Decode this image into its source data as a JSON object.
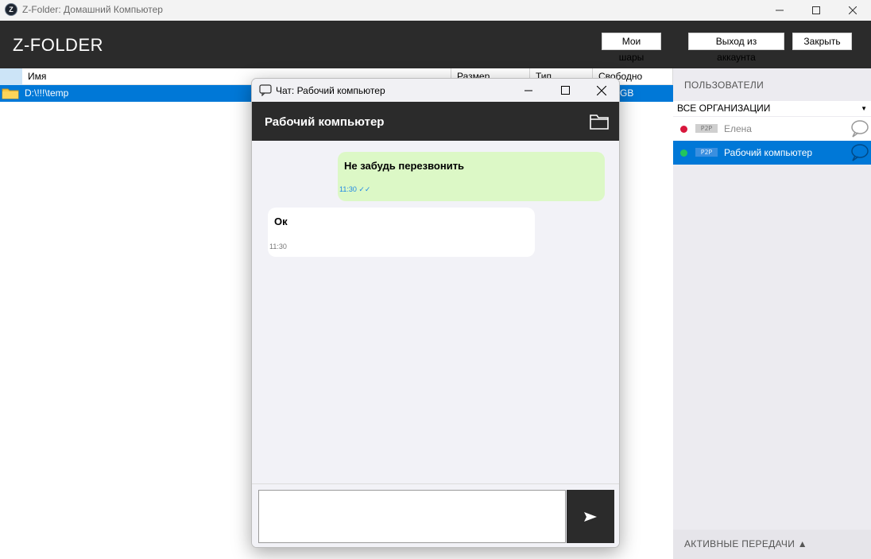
{
  "window": {
    "app_icon_letter": "Z",
    "title": "Z-Folder: Домашний Компьютер"
  },
  "header": {
    "brand": "Z-FOLDER",
    "my_shares_label": "Мои шары",
    "logout_label": "Выход из аккаунта",
    "close_label": "Закрыть"
  },
  "table": {
    "columns": [
      "Имя",
      "Размер",
      "Тип",
      "Свободно"
    ],
    "rows": [
      {
        "name": "D:\\!!!\\temp",
        "size": "",
        "type": "",
        "free": "GB"
      }
    ]
  },
  "users_panel": {
    "title": "ПОЛЬЗОВАТЕЛИ",
    "org_filter": "ВСЕ ОРГАНИЗАЦИИ",
    "users": [
      {
        "name": "Елена",
        "badge": "P2P",
        "status_color": "#d8173c",
        "selected": false
      },
      {
        "name": "Рабочий компьютер",
        "badge": "P2P",
        "status_color": "#22c55e",
        "selected": true
      }
    ],
    "transfers_label": "АКТИВНЫЕ ПЕРЕДАЧИ ▲"
  },
  "chat": {
    "window_title": "Чат: Рабочий компьютер",
    "peer_name": "Рабочий компьютер",
    "messages": [
      {
        "text": "Не забудь перезвонить",
        "time": "11:30 ✓✓",
        "outgoing": true
      },
      {
        "text": "Ок",
        "time": "11:30",
        "outgoing": false
      }
    ],
    "input_value": "",
    "send_icon": "send-arrow-icon"
  },
  "colors": {
    "accent": "#0078d7",
    "header_bg": "#2b2b2b",
    "outgoing_bubble": "#dcf8c6",
    "online": "#22c55e",
    "offline": "#d8173c"
  }
}
